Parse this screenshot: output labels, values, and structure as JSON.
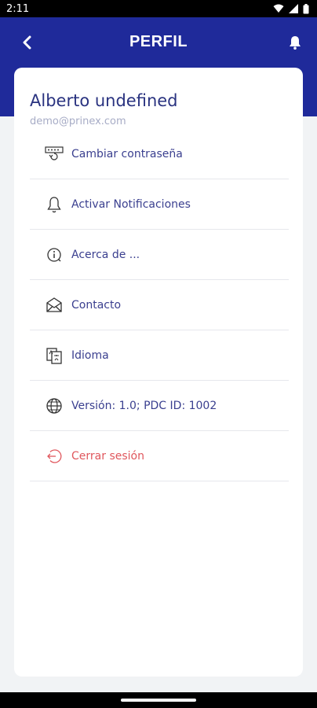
{
  "status_bar": {
    "time": "2:11"
  },
  "header": {
    "title": "PERFIL"
  },
  "profile": {
    "name": "Alberto undefined",
    "email": "demo@prinex.com"
  },
  "menu": [
    {
      "label": "Cambiar contraseña",
      "icon": "password-icon"
    },
    {
      "label": "Activar Notificaciones",
      "icon": "bell-icon"
    },
    {
      "label": "Acerca de ...",
      "icon": "info-icon"
    },
    {
      "label": "Contacto",
      "icon": "mail-icon"
    },
    {
      "label": "Idioma",
      "icon": "language-icon"
    },
    {
      "label": "Versión: 1.0; PDC ID: 1002",
      "icon": "globe-icon"
    },
    {
      "label": "Cerrar sesión",
      "icon": "logout-icon"
    }
  ],
  "colors": {
    "header": "#1f2a9a",
    "text": "#3a3f8f",
    "logout": "#e0575d"
  }
}
